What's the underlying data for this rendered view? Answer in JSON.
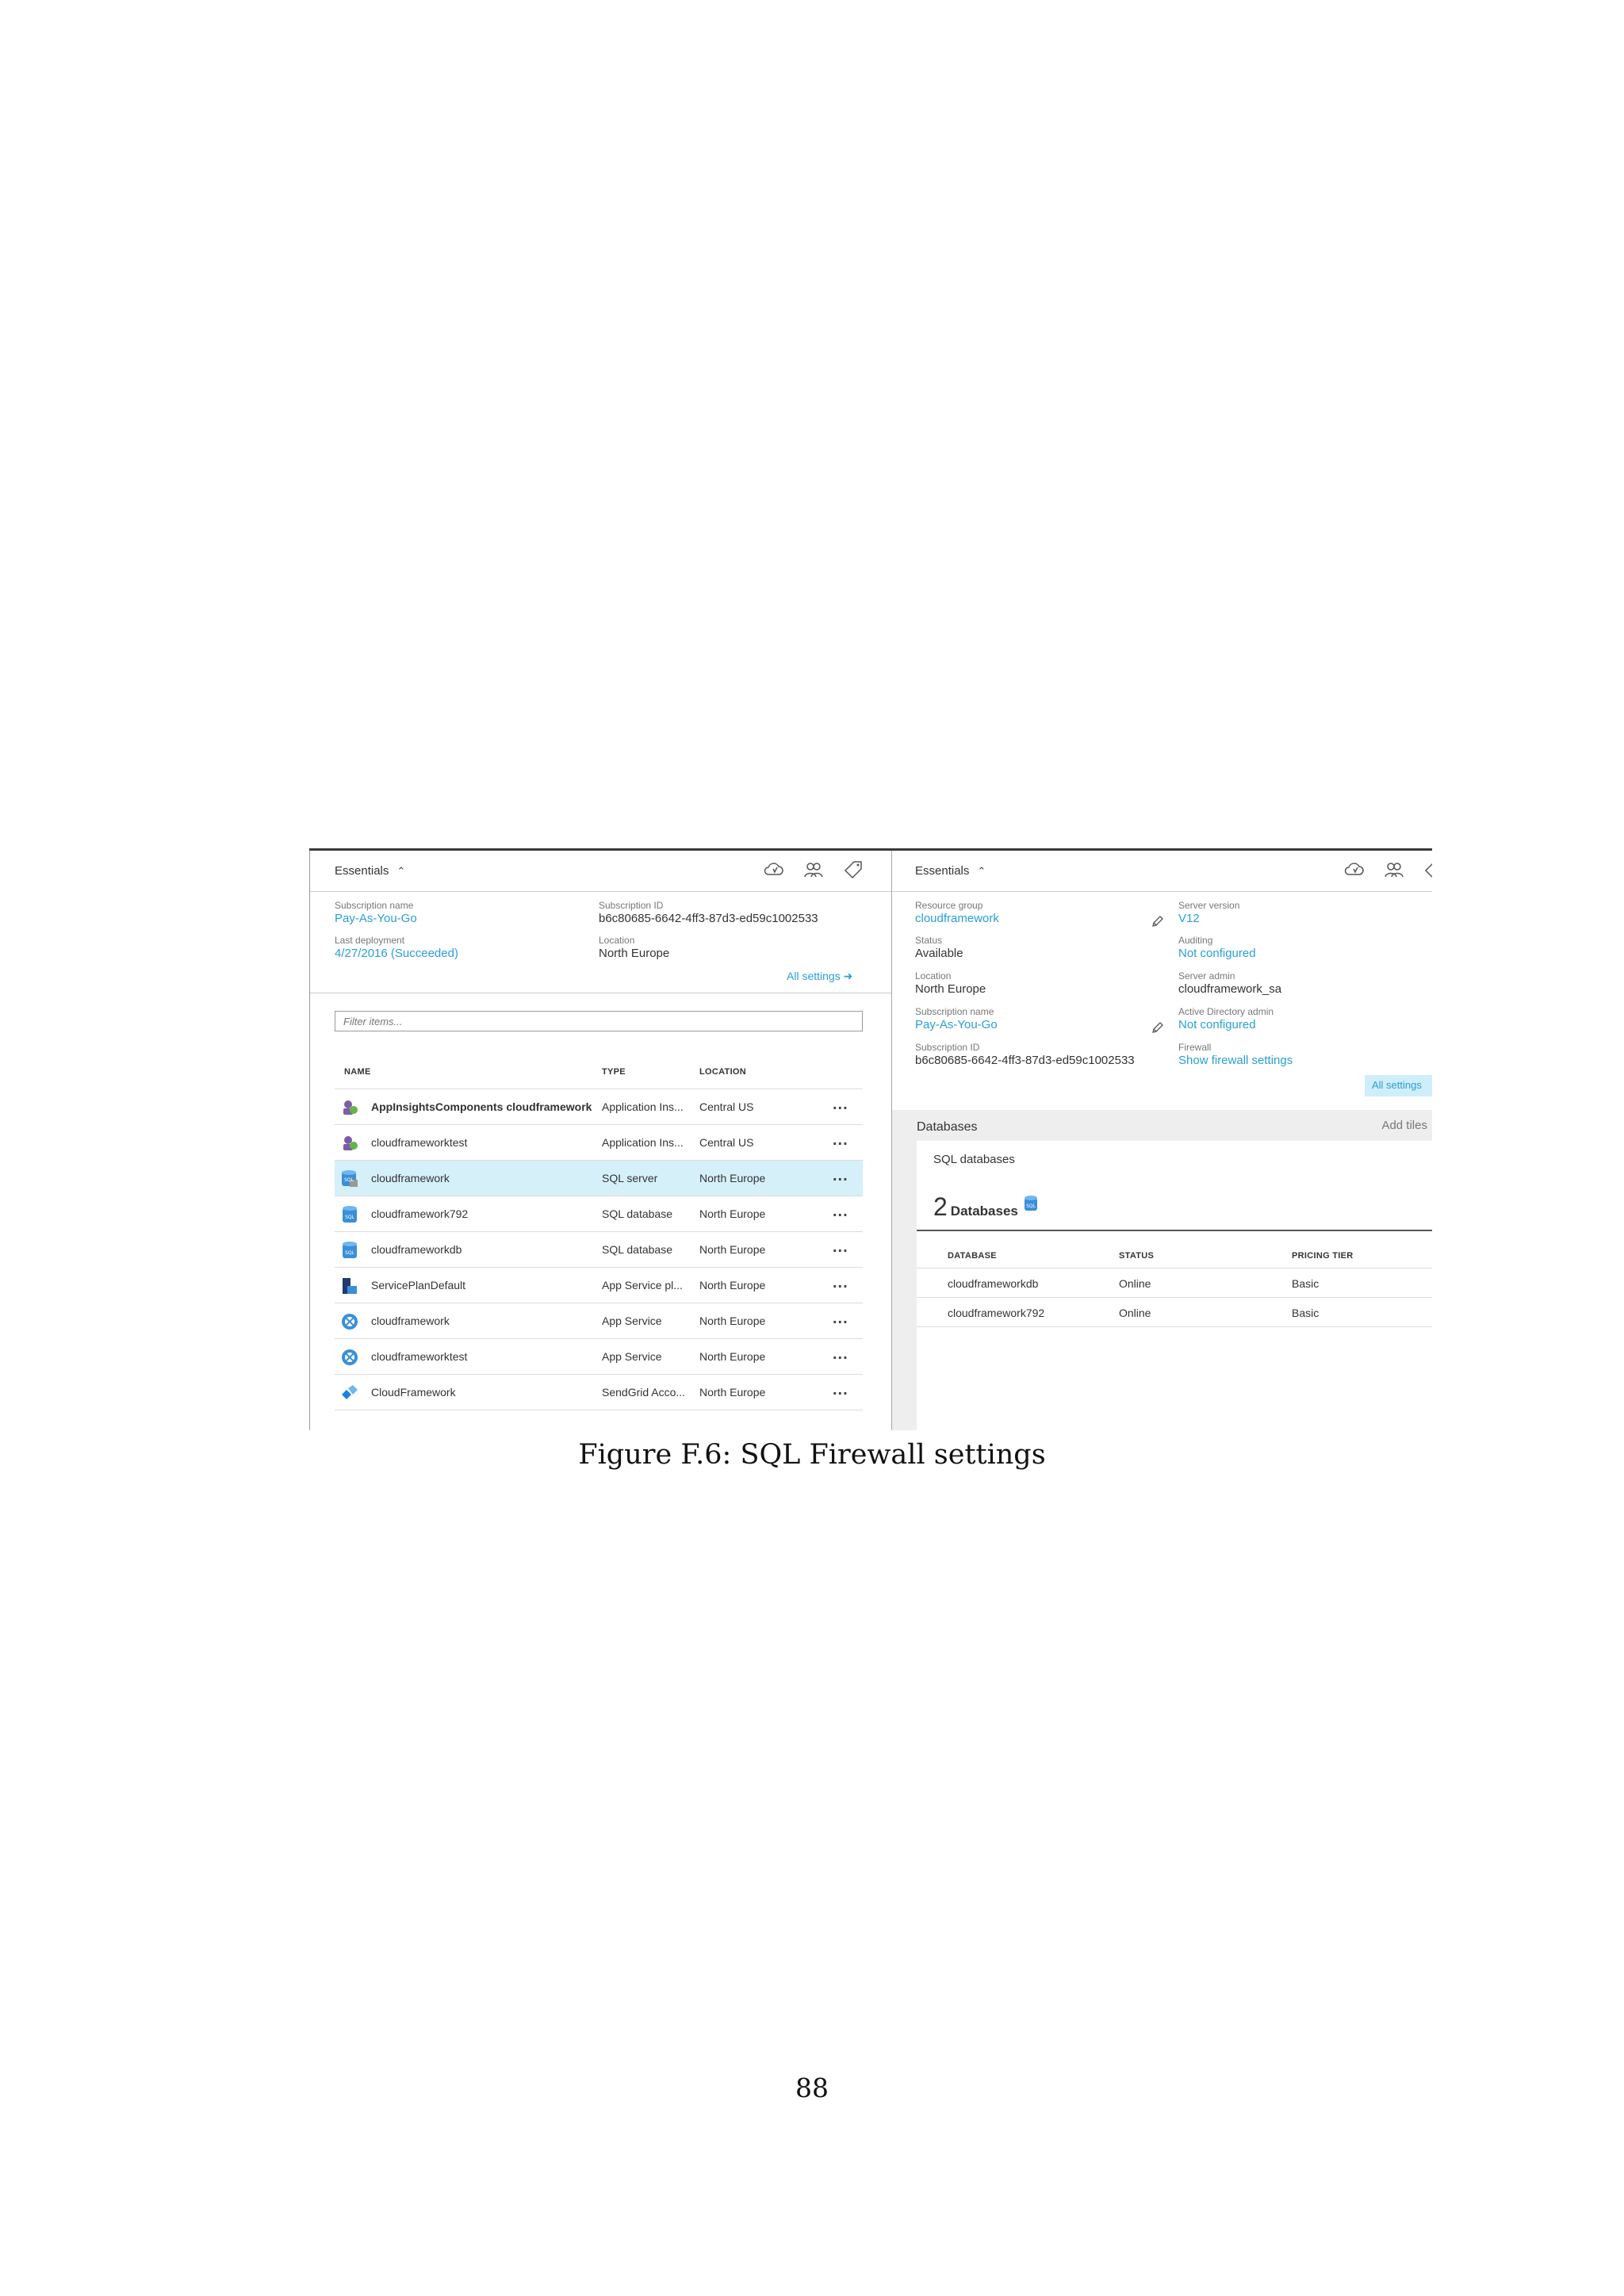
{
  "left_panel": {
    "essentials_label": "Essentials",
    "fields": {
      "subscription_name_label": "Subscription name",
      "subscription_name": "Pay-As-You-Go",
      "subscription_id_label": "Subscription ID",
      "subscription_id": "b6c80685-6642-4ff3-87d3-ed59c1002533",
      "last_deployment_label": "Last deployment",
      "last_deployment": "4/27/2016 (Succeeded)",
      "location_label": "Location",
      "location": "North Europe"
    },
    "all_settings": "All settings",
    "filter_placeholder": "Filter items...",
    "columns": {
      "name": "NAME",
      "type": "TYPE",
      "location": "LOCATION"
    },
    "rows": [
      {
        "name": "AppInsightsComponents cloudframework",
        "type": "Application Ins...",
        "location": "Central US",
        "icon": "app-insights-icon",
        "bold": true
      },
      {
        "name": "cloudframeworktest",
        "type": "Application Ins...",
        "location": "Central US",
        "icon": "app-insights-icon",
        "bold": false
      },
      {
        "name": "cloudframework",
        "type": "SQL server",
        "location": "North Europe",
        "icon": "sql-server-icon",
        "bold": false,
        "selected": true
      },
      {
        "name": "cloudframework792",
        "type": "SQL database",
        "location": "North Europe",
        "icon": "sql-database-icon",
        "bold": false
      },
      {
        "name": "cloudframeworkdb",
        "type": "SQL database",
        "location": "North Europe",
        "icon": "sql-database-icon",
        "bold": false
      },
      {
        "name": "ServicePlanDefault",
        "type": "App Service pl...",
        "location": "North Europe",
        "icon": "app-service-plan-icon",
        "bold": false
      },
      {
        "name": "cloudframework",
        "type": "App Service",
        "location": "North Europe",
        "icon": "app-service-icon",
        "bold": false
      },
      {
        "name": "cloudframeworktest",
        "type": "App Service",
        "location": "North Europe",
        "icon": "app-service-icon",
        "bold": false
      },
      {
        "name": "CloudFramework",
        "type": "SendGrid Acco...",
        "location": "North Europe",
        "icon": "sendgrid-icon",
        "bold": false
      }
    ],
    "more": "..."
  },
  "right_panel": {
    "essentials_label": "Essentials",
    "fields": {
      "resource_group_label": "Resource group",
      "resource_group": "cloudframework",
      "server_version_label": "Server version",
      "server_version": "V12",
      "status_label": "Status",
      "status": "Available",
      "auditing_label": "Auditing",
      "auditing": "Not configured",
      "location_label": "Location",
      "location": "North Europe",
      "server_admin_label": "Server admin",
      "server_admin": "cloudframework_sa",
      "subscription_name_label": "Subscription name",
      "subscription_name": "Pay-As-You-Go",
      "ad_admin_label": "Active Directory admin",
      "ad_admin": "Not configured",
      "subscription_id_label": "Subscription ID",
      "subscription_id": "b6c80685-6642-4ff3-87d3-ed59c1002533",
      "firewall_label": "Firewall",
      "firewall": "Show firewall settings"
    },
    "all_settings": "All settings",
    "databases_label": "Databases",
    "add_tiles": "Add tiles",
    "sql_databases_label": "SQL databases",
    "db_count": "2",
    "db_count_word": "Databases",
    "columns": {
      "database": "DATABASE",
      "status": "STATUS",
      "pricing_tier": "PRICING TIER"
    },
    "rows": [
      {
        "database": "cloudframeworkdb",
        "status": "Online",
        "pricing_tier": "Basic"
      },
      {
        "database": "cloudframework792",
        "status": "Online",
        "pricing_tier": "Basic"
      }
    ]
  },
  "caption": "Figure F.6: SQL Firewall settings",
  "page_number": "88",
  "colors": {
    "link": "#2a9fd6",
    "selected_row": "#d6f0fa"
  }
}
